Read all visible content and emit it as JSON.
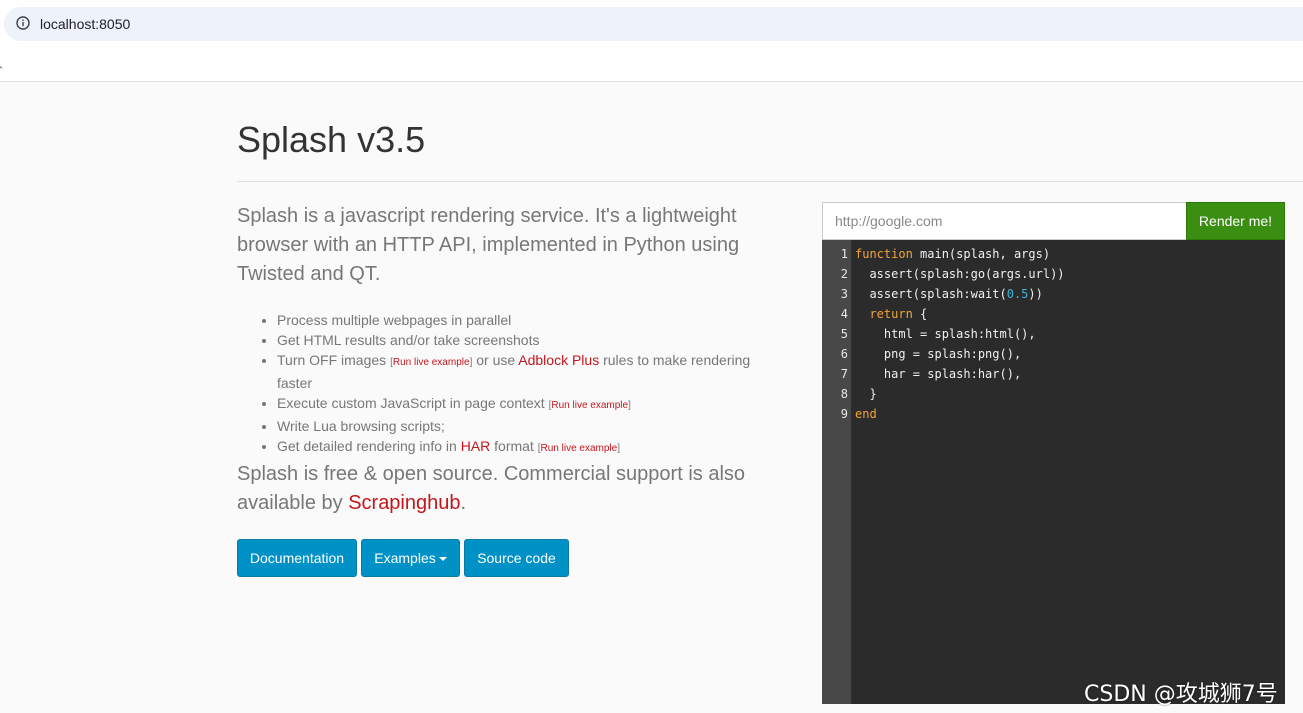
{
  "browser": {
    "url": "localhost:8050"
  },
  "page": {
    "title": "Splash v3.5",
    "lead": "Splash is a javascript rendering service. It's a lightweight browser with an HTTP API, implemented in Python using Twisted and QT.",
    "features": {
      "f1": "Process multiple webpages in parallel",
      "f2": "Get HTML results and/or take screenshots",
      "f3_a": "Turn OFF images ",
      "f3_b": " or use ",
      "f3_adblock": "Adblock Plus",
      "f3_c": " rules to make rendering faster",
      "f4": "Execute custom JavaScript in page context ",
      "f5": "Write Lua browsing scripts;",
      "f6_a": "Get detailed rendering info in ",
      "f6_har": "HAR",
      "f6_b": " format ",
      "live_example": "Run live example",
      "bracket_open": "[",
      "bracket_close": "]"
    },
    "lead2_a": "Splash is free & open source. Commercial support is also available by ",
    "lead2_link": "Scrapinghub",
    "lead2_b": ".",
    "buttons": {
      "documentation": "Documentation",
      "examples": "Examples",
      "source": "Source code"
    }
  },
  "render_form": {
    "url_placeholder": "http://google.com",
    "render_button": "Render me!"
  },
  "editor": {
    "line_numbers": [
      "1",
      "2",
      "3",
      "4",
      "5",
      "6",
      "7",
      "8",
      "9"
    ],
    "l1_kw": "function",
    "l1_rest": " main(splash, args)",
    "l2": "  assert(splash:go(args.url))",
    "l3_a": "  assert(splash:wait(",
    "l3_num": "0.5",
    "l3_b": "))",
    "l4_indent": "  ",
    "l4_kw": "return",
    "l4_rest": " {",
    "l5": "    html = splash:html(),",
    "l6": "    png = splash:png(),",
    "l7": "    har = splash:har(),",
    "l8": "  }",
    "l9_kw": "end"
  },
  "watermark": "CSDN @攻城狮7号",
  "colors": {
    "link_red": "#c4161c",
    "button_blue": "#0092c7",
    "render_green": "#3a8e12",
    "editor_bg": "#2b2b2b",
    "keyword_orange": "#f3a43a",
    "number_blue": "#3fb3d6"
  },
  "icons": {
    "address_info": "info-icon"
  }
}
